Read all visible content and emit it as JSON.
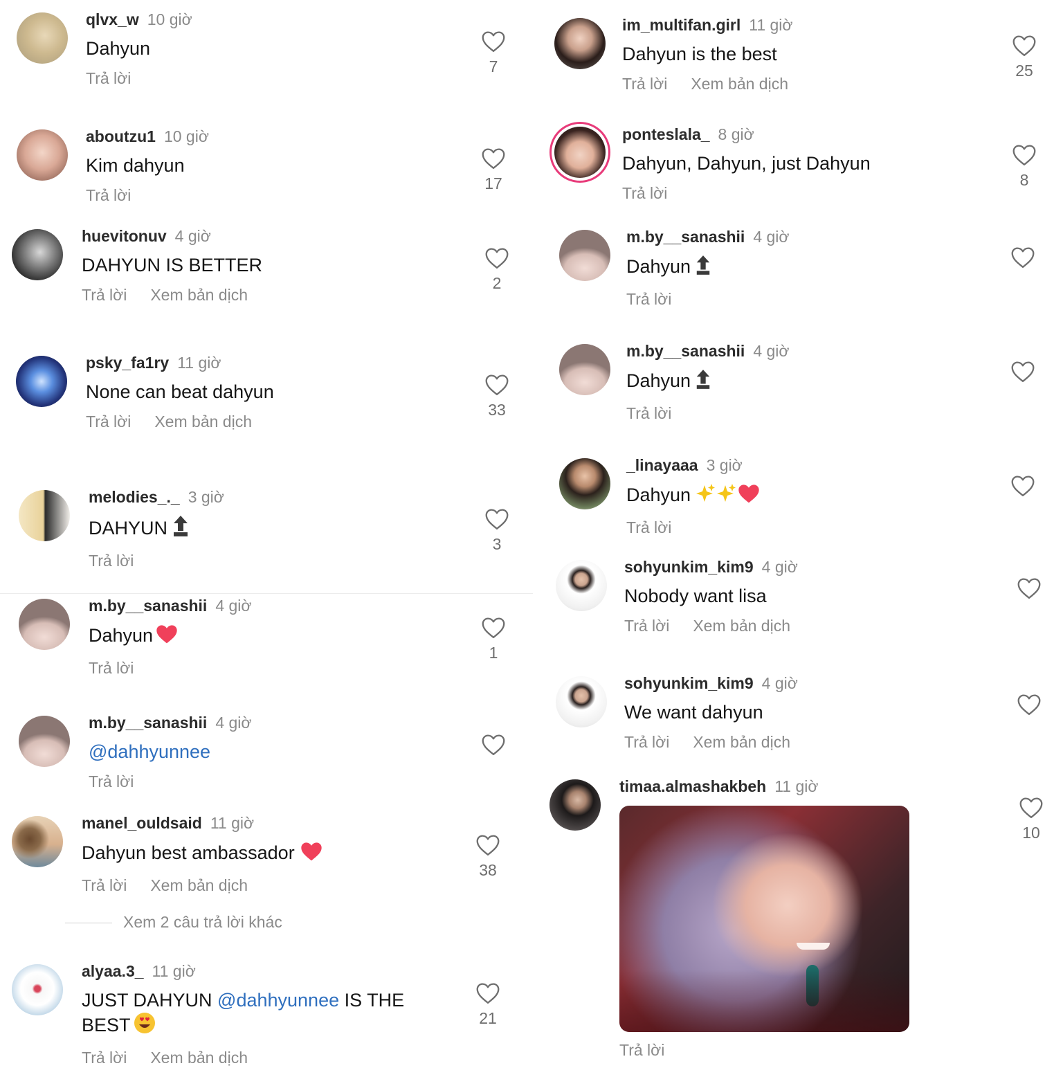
{
  "labels": {
    "reply": "Trả lời",
    "translate": "Xem bản dịch"
  },
  "colors": {
    "mention": "#2f6fbe",
    "heart_emoji": "#f0405a",
    "username": "#2b2b2b",
    "muted": "#8a8a8a"
  },
  "icons": {
    "like": "heart-outline-icon",
    "top": "top-arrow-icon",
    "emoji_heart": "red-heart-emoji",
    "emoji_sparkles": "sparkles-emoji",
    "emoji_heart_eyes": "heart-eyes-emoji"
  },
  "left": [
    {
      "user": "qlvx_w",
      "time": "10 giờ",
      "text": "Dahyun",
      "likes": "7"
    },
    {
      "user": "aboutzu1",
      "time": "10 giờ",
      "text": "Kim dahyun",
      "likes": "17"
    },
    {
      "user": "huevitonuv",
      "time": "4 giờ",
      "text": "DAHYUN IS BETTER",
      "likes": "2"
    },
    {
      "user": "psky_fa1ry",
      "time": "11 giờ",
      "text": "None can beat dahyun",
      "likes": "33"
    },
    {
      "user": "melodies_._",
      "time": "3 giờ",
      "text": "DAHYUN",
      "likes": "3"
    },
    {
      "user": "m.by__sanashii",
      "time": "4 giờ",
      "text": "Dahyun",
      "likes": "1"
    },
    {
      "user": "m.by__sanashii",
      "time": "4 giờ",
      "text": "@dahhyunnee",
      "likes": ""
    },
    {
      "user": "manel_ouldsaid",
      "time": "11 giờ",
      "text": "Dahyun best ambassador",
      "likes": "38"
    },
    {
      "user": "alyaa.3_",
      "time": "11 giờ",
      "text_before": "JUST DAHYUN",
      "mention": "@dahhyunnee",
      "text_after": "IS THE BEST",
      "likes": "21"
    }
  ],
  "more_replies": "Xem 2 câu trả lời khác",
  "right": [
    {
      "user": "im_multifan.girl",
      "time": "11 giờ",
      "text": "Dahyun is the best",
      "likes": "25"
    },
    {
      "user": "ponteslala_",
      "time": "8 giờ",
      "text": "Dahyun, Dahyun, just Dahyun",
      "likes": "8"
    },
    {
      "user": "m.by__sanashii",
      "time": "4 giờ",
      "text": "Dahyun",
      "likes": ""
    },
    {
      "user": "m.by__sanashii",
      "time": "4 giờ",
      "text": "Dahyun",
      "likes": ""
    },
    {
      "user": "_linayaaa",
      "time": "3 giờ",
      "text": "Dahyun",
      "likes": ""
    },
    {
      "user": "sohyunkim_kim9",
      "time": "4 giờ",
      "text": "Nobody want lisa",
      "likes": ""
    },
    {
      "user": "sohyunkim_kim9",
      "time": "4 giờ",
      "text": "We want dahyun",
      "likes": ""
    },
    {
      "user": "timaa.almashakbeh",
      "time": "11 giờ",
      "likes": "10"
    }
  ]
}
